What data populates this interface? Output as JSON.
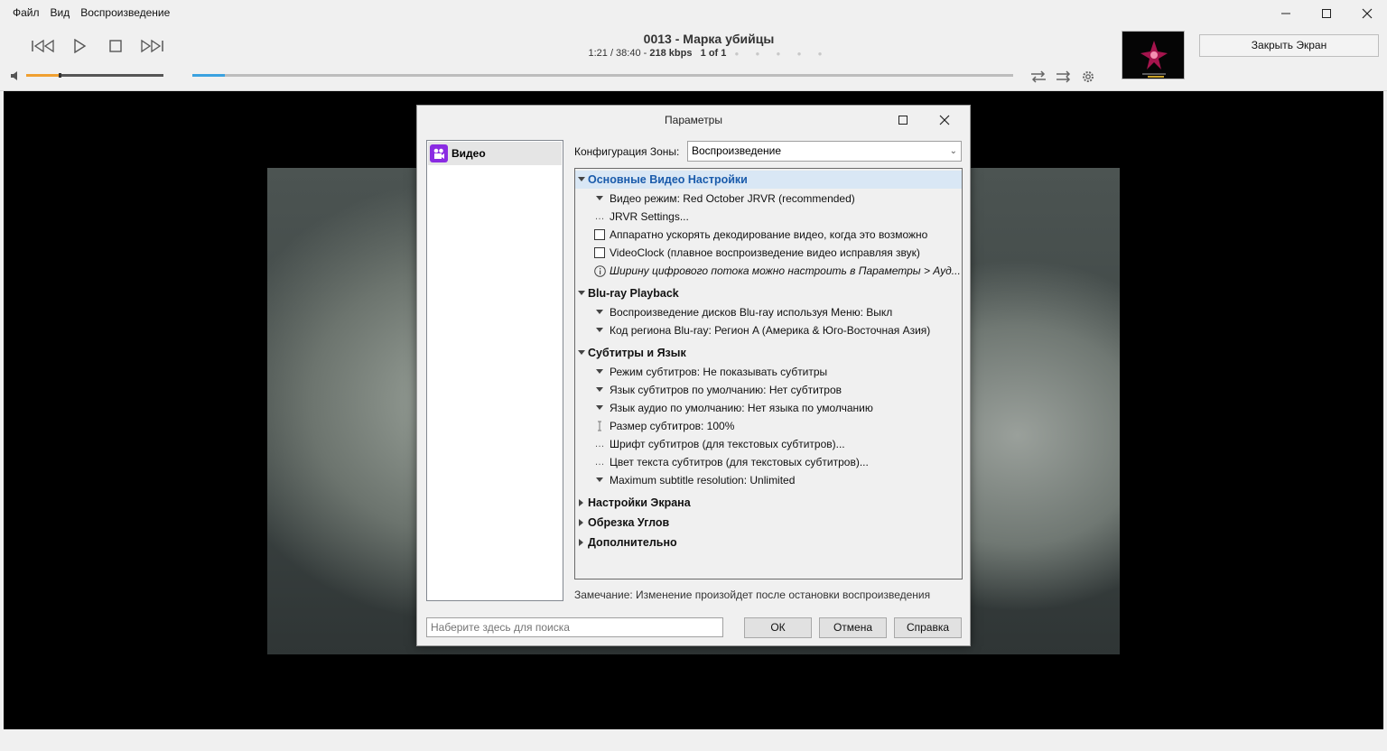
{
  "menu": [
    "Файл",
    "Вид",
    "Воспроизведение"
  ],
  "now_playing": {
    "title": "0013 - Марка убийцы",
    "position": "1:21 / 38:40 -",
    "bitrate": "218 kbps",
    "playlist_pos": "1 of 1",
    "rating_stars": "● ● ● ● ●"
  },
  "volume_level": 0.24,
  "seek_progress": 0.04,
  "close_screen_label": "Закрыть Экран",
  "dialog": {
    "title": "Параметры",
    "nav_item": "Видео",
    "zone_label": "Конфигурация Зоны:",
    "zone_value": "Воспроизведение",
    "sections": {
      "basic": "Основные Видео Настройки",
      "bluray": "Blu-ray Playback",
      "subs": "Субтитры и Язык",
      "display": "Настройки Экрана",
      "crop": "Обрезка Углов",
      "advanced": "Дополнительно"
    },
    "items": {
      "video_mode": "Видео режим: Red October JRVR (recommended)",
      "jrvr": "JRVR Settings...",
      "hw_decode": "Аппаратно ускорять декодирование видео, когда это возможно",
      "videoclock": "VideoClock (плавное воспроизведение видео исправляя звук)",
      "bitstream_info": "Ширину цифрового потока можно настроить в Параметры > Ауд...",
      "bluray_menu": "Воспроизведение дисков Blu-ray используя Меню: Выкл",
      "bluray_region": "Код региона Blu-ray: Регион A (Америка & Юго-Восточная Азия)",
      "sub_mode": "Режим субтитров: Не показывать субтитры",
      "sub_lang": "Язык субтитров по умолчанию: Нет субтитров",
      "audio_lang": "Язык аудио по умолчанию: Нет языка по умолчанию",
      "sub_size": "Размер субтитров: 100%",
      "sub_font": "Шрифт субтитров (для текстовых субтитров)...",
      "sub_color": "Цвет текста субтитров (для текстовых субтитров)...",
      "sub_maxres": "Maximum subtitle resolution: Unlimited"
    },
    "note": "Замечание: Изменение произойдет после остановки воспроизведения",
    "search_placeholder": "Наберите здесь для поиска",
    "ok": "ОК",
    "cancel": "Отмена",
    "help": "Справка"
  },
  "colors": {
    "volume_fill": "#f0a030",
    "seek_fill": "#3ba2e0",
    "selected_header_text": "#1a5bab",
    "nav_icon": "#8a2be2"
  }
}
